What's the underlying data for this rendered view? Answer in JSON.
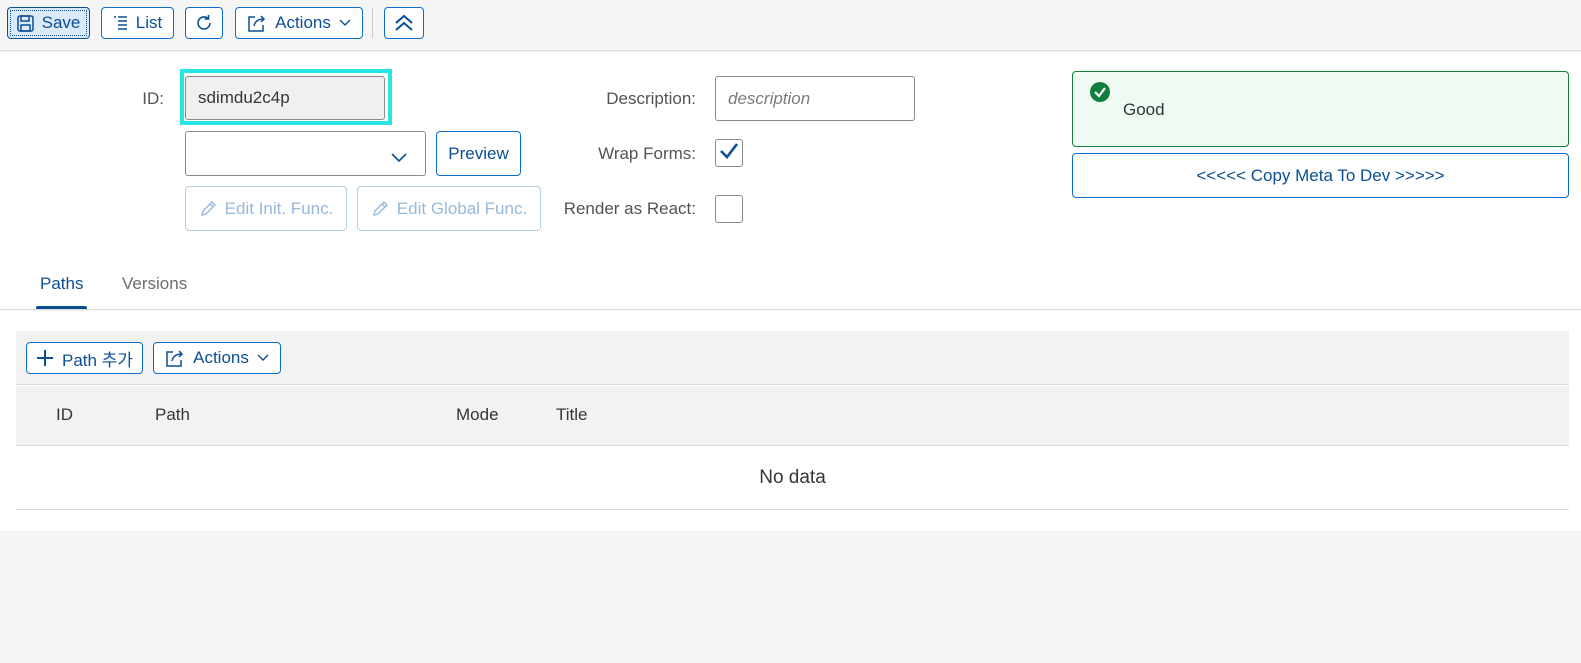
{
  "toolbar": {
    "save_label": "Save",
    "list_label": "List",
    "actions_label": "Actions"
  },
  "form": {
    "id_label": "ID:",
    "id_value": "sdimdu2c4p",
    "preview_label": "Preview",
    "edit_init_label": "Edit Init. Func.",
    "edit_global_label": "Edit Global Func.",
    "description_label": "Description:",
    "description_placeholder": "description",
    "wrap_forms_label": "Wrap Forms:",
    "wrap_forms_checked": true,
    "render_react_label": "Render as React:",
    "render_react_checked": false
  },
  "message": {
    "text": "Good",
    "type": "success",
    "color": "#107e3e"
  },
  "copy_button_label": "<<<<< Copy Meta To Dev >>>>>",
  "tabs": [
    {
      "label": "Paths",
      "active": true
    },
    {
      "label": "Versions",
      "active": false
    }
  ],
  "table": {
    "add_label": "Path 추가",
    "actions_label": "Actions",
    "columns": [
      "ID",
      "Path",
      "Mode",
      "Title"
    ],
    "empty_text": "No data"
  },
  "colors": {
    "accent": "#0a6ed1",
    "focus": "#27e6e6",
    "success_bg": "#effaf2"
  }
}
